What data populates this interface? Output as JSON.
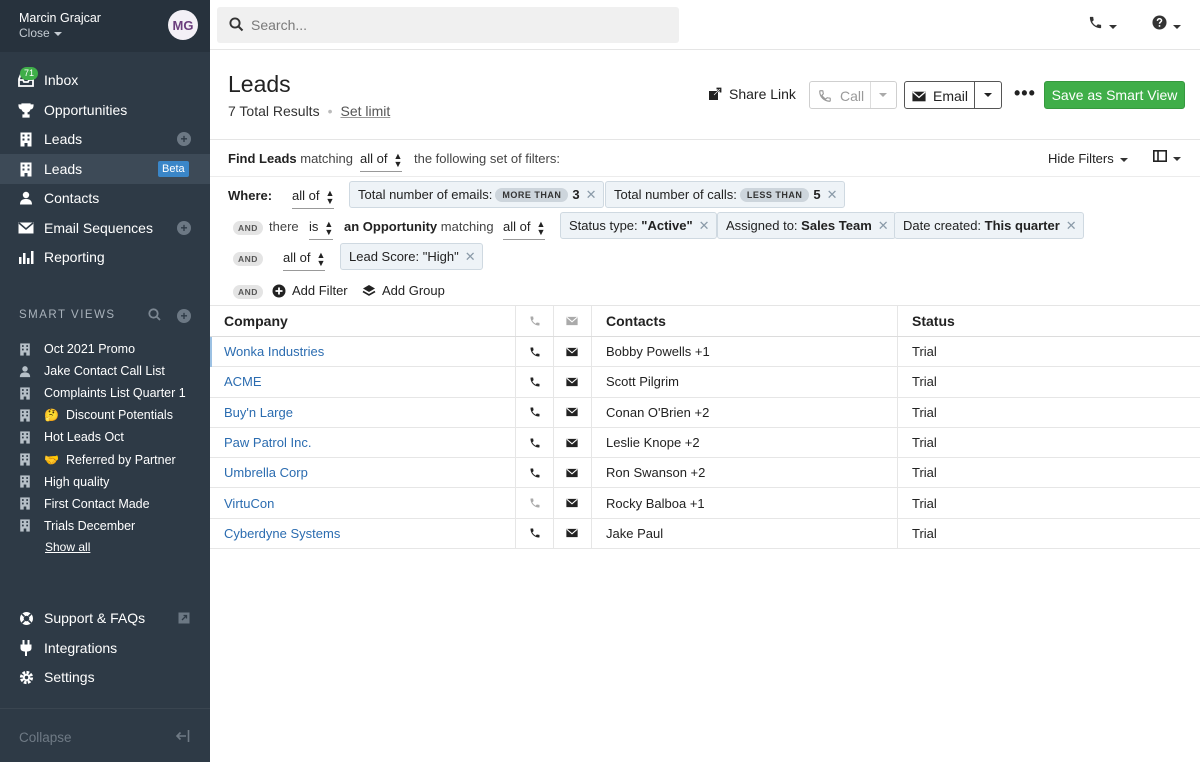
{
  "sidebar": {
    "user_name": "Marcin Grajcar",
    "org_name": "Close",
    "avatar_initials": "MG",
    "inbox_count": "71",
    "nav": [
      {
        "label": "Inbox",
        "icon": "inbox-icon"
      },
      {
        "label": "Opportunities",
        "icon": "trophy-icon"
      },
      {
        "label": "Leads",
        "icon": "building-icon"
      },
      {
        "label": "Leads",
        "icon": "building-icon",
        "badge": "Beta"
      },
      {
        "label": "Contacts",
        "icon": "person-icon"
      },
      {
        "label": "Email Sequences",
        "icon": "envelope-icon"
      },
      {
        "label": "Reporting",
        "icon": "bar-chart-icon"
      }
    ],
    "smart_views_header": "SMART VIEWS",
    "smart_views": [
      {
        "label": "Oct 2021 Promo",
        "emoji": ""
      },
      {
        "label": "Jake Contact Call List",
        "emoji": ""
      },
      {
        "label": "Complaints List Quarter 1",
        "emoji": ""
      },
      {
        "label": "Discount Potentials",
        "emoji": "🤔"
      },
      {
        "label": "Hot Leads Oct",
        "emoji": ""
      },
      {
        "label": "Referred by Partner",
        "emoji": "🤝"
      },
      {
        "label": "High quality",
        "emoji": ""
      },
      {
        "label": "First Contact Made",
        "emoji": ""
      },
      {
        "label": "Trials December",
        "emoji": ""
      }
    ],
    "show_all": "Show all",
    "bottom_nav": [
      {
        "label": "Support & FAQs"
      },
      {
        "label": "Integrations"
      },
      {
        "label": "Settings"
      }
    ],
    "collapse_label": "Collapse"
  },
  "topbar": {
    "search_placeholder": "Search..."
  },
  "header": {
    "title": "Leads",
    "total_results": "7 Total Results",
    "set_limit": "Set limit",
    "share_link": "Share Link",
    "call": "Call",
    "email": "Email",
    "save_smart_view": "Save as Smart View"
  },
  "filters": {
    "find_leads": "Find Leads",
    "matching": "matching",
    "all_of": "all of",
    "following_set": "the following set of filters:",
    "hide_filters": "Hide Filters",
    "where": "Where:",
    "and": "AND",
    "there": "there",
    "is": "is",
    "an_opportunity": "an Opportunity",
    "chip_emails_label": "Total number of emails:",
    "chip_emails_op": "MORE THAN",
    "chip_emails_val": "3",
    "chip_calls_label": "Total number of calls:",
    "chip_calls_op": "LESS THAN",
    "chip_calls_val": "5",
    "chip_status": "Status type: ",
    "chip_status_val": "\"Active\"",
    "chip_assigned": "Assigned to: ",
    "chip_assigned_val": "Sales Team",
    "chip_date": "Date created: ",
    "chip_date_val": "This quarter",
    "chip_score": "Lead Score: ",
    "chip_score_val": "\"High\"",
    "add_filter": "Add Filter",
    "add_group": "Add Group"
  },
  "table": {
    "columns": {
      "company": "Company",
      "contacts": "Contacts",
      "status": "Status"
    },
    "rows": [
      {
        "company": "Wonka Industries",
        "contacts": "Bobby Powells +1",
        "status": "Trial",
        "phone_active": true
      },
      {
        "company": "ACME",
        "contacts": "Scott Pilgrim",
        "status": "Trial",
        "phone_active": true
      },
      {
        "company": "Buy'n Large",
        "contacts": "Conan O'Brien +2",
        "status": "Trial",
        "phone_active": true
      },
      {
        "company": "Paw Patrol Inc.",
        "contacts": "Leslie Knope +2",
        "status": "Trial",
        "phone_active": true
      },
      {
        "company": "Umbrella Corp",
        "contacts": "Ron Swanson +2",
        "status": "Trial",
        "phone_active": true
      },
      {
        "company": "VirtuCon",
        "contacts": "Rocky Balboa +1",
        "status": "Trial",
        "phone_active": false
      },
      {
        "company": "Cyberdyne Systems",
        "contacts": "Jake Paul",
        "status": "Trial",
        "phone_active": true
      }
    ]
  },
  "colors": {
    "sidebar_bg": "#2e3a46",
    "accent_green": "#3fae49",
    "link_blue": "#2b6cb0",
    "beta_blue": "#3a86c8"
  }
}
